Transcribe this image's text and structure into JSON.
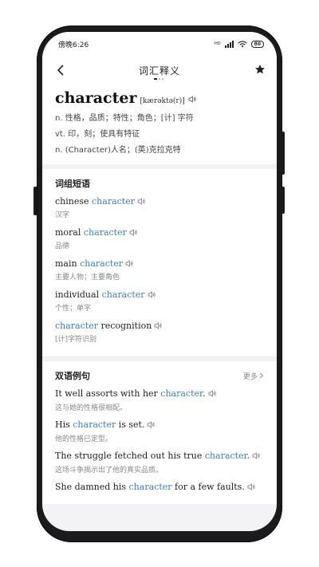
{
  "status": {
    "time": "傍晚6:26",
    "signal": "HD",
    "battery": "80"
  },
  "nav": {
    "title": "词汇释义"
  },
  "word": {
    "headword": "character",
    "phonetic": "[kærəktə(r)]",
    "definitions": [
      "n. 性格，品质；特性；角色；[计] 字符",
      "vt. 印，刻；使具有特征",
      "n. (Character)人名；(英)克拉克特"
    ]
  },
  "phrases": {
    "title": "词组短语",
    "items": [
      {
        "pre": "chinese ",
        "hl": "character",
        "post": "",
        "cn": "汉字"
      },
      {
        "pre": "moral ",
        "hl": "character",
        "post": "",
        "cn": "品德"
      },
      {
        "pre": "main ",
        "hl": "character",
        "post": "",
        "cn": "主要人物；主要角色"
      },
      {
        "pre": "individual ",
        "hl": "character",
        "post": "",
        "cn": "个性；单字"
      },
      {
        "pre": "",
        "hl": "character",
        "post": " recognition",
        "cn": "[计]字符识别"
      }
    ]
  },
  "examples": {
    "title": "双语例句",
    "more": "更多",
    "items": [
      {
        "pre": "It well assorts with her ",
        "hl": "character",
        "post": ".",
        "cn": "这与她的性格很相配。"
      },
      {
        "pre": "His ",
        "hl": "character",
        "post": " is set.",
        "cn": "他的性格已定型。"
      },
      {
        "pre": "The struggle fetched out his true ",
        "hl": "character",
        "post": ".",
        "cn": "这场斗争揭示出了他的真实品质。"
      },
      {
        "pre": "She damned his ",
        "hl": "character",
        "post": " for a few faults.",
        "cn": ""
      }
    ]
  },
  "colors": {
    "accent": "#3a7fc7",
    "frame": "#1b1b1e"
  }
}
